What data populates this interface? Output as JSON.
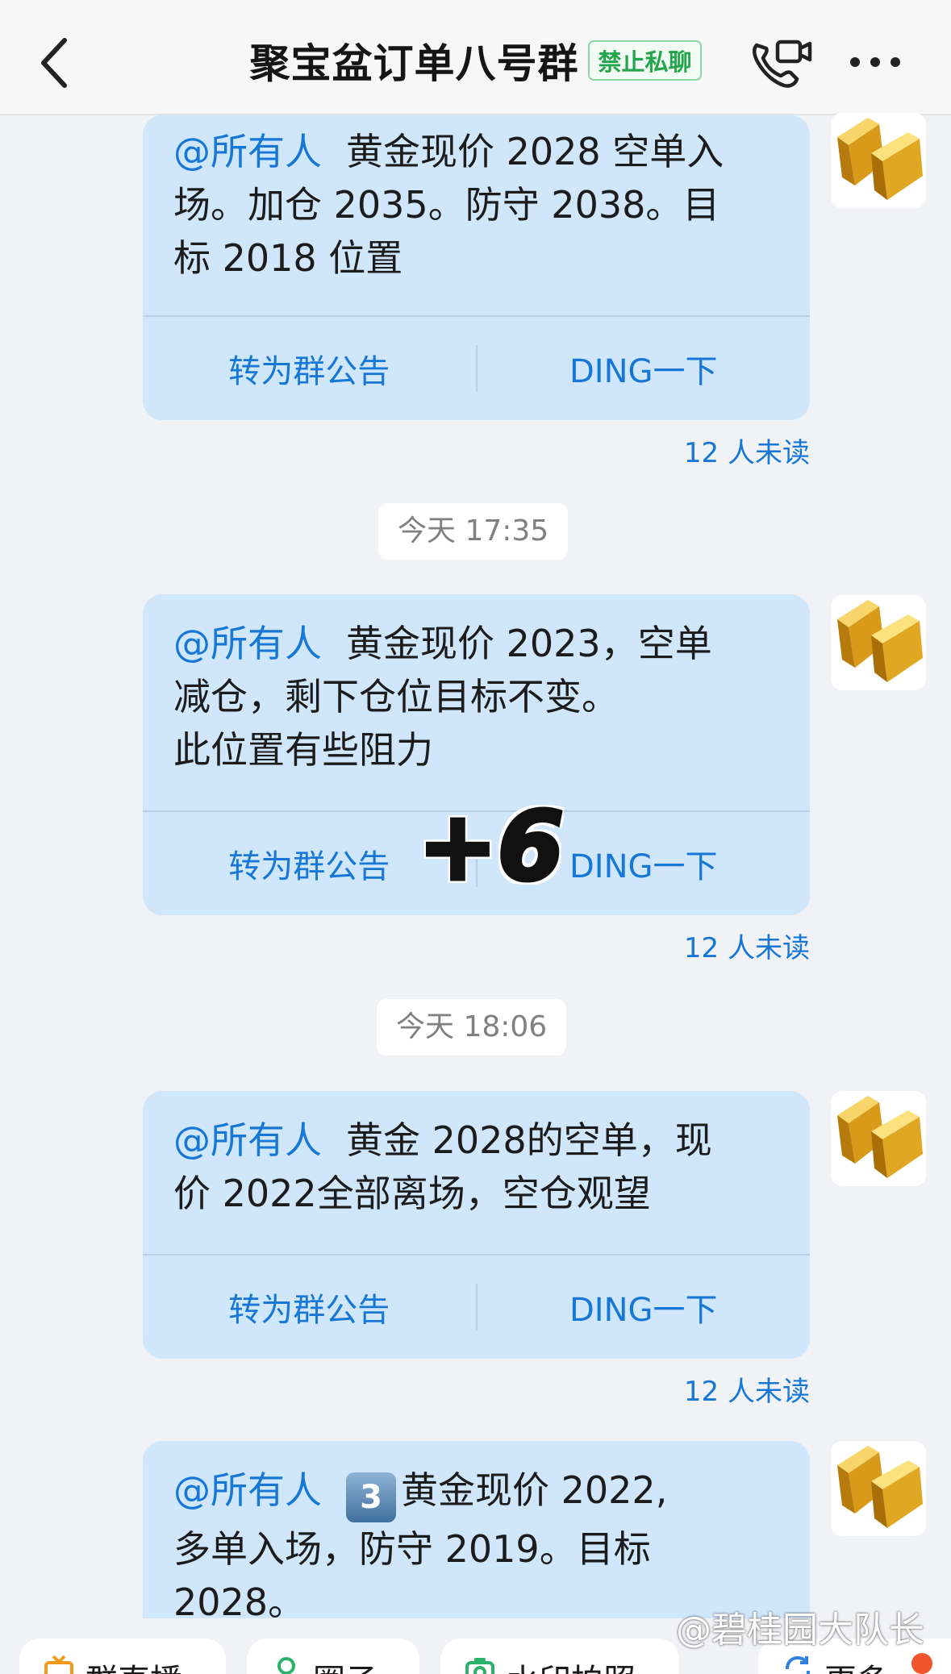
{
  "header": {
    "title": "聚宝盆订单八号群",
    "badge": "禁止私聊"
  },
  "messages": [
    {
      "mention": "@所有人",
      "text_lines": [
        "黄金现价 2028 空单入",
        "场。加仓 2035。防守 2038。目",
        "标 2018 位置"
      ],
      "actions": [
        "转为群公告",
        "DING一下"
      ],
      "unread": "12 人未读"
    },
    {
      "timestamp": "今天 17:35",
      "mention": "@所有人",
      "text_lines": [
        "黄金现价 2023，空单",
        "减仓，剩下仓位目标不变。",
        "此位置有些阻力"
      ],
      "actions": [
        "转为群公告",
        "DING一下"
      ],
      "unread": "12 人未读"
    },
    {
      "timestamp": "今天 18:06",
      "mention": "@所有人",
      "text_lines": [
        "黄金 2028的空单，现",
        "价 2022全部离场，空仓观望"
      ],
      "actions": [
        "转为群公告",
        "DING一下"
      ],
      "unread": "12 人未读"
    },
    {
      "mention": "@所有人",
      "keycap": "3",
      "text_lines": [
        "黄金现价 2022,",
        "多单入场，防守 2019。目标",
        "2028。"
      ]
    }
  ],
  "overlay": "+6",
  "bottom_bar": {
    "items": [
      "群直播",
      "圈子",
      "水印拍照",
      "更多"
    ]
  },
  "watermark": "@碧桂园大队长",
  "colors": {
    "bubble": "#cfe6fb",
    "accent": "#1677d6",
    "badge_green": "#23a54b",
    "background": "#f1f2f5"
  }
}
